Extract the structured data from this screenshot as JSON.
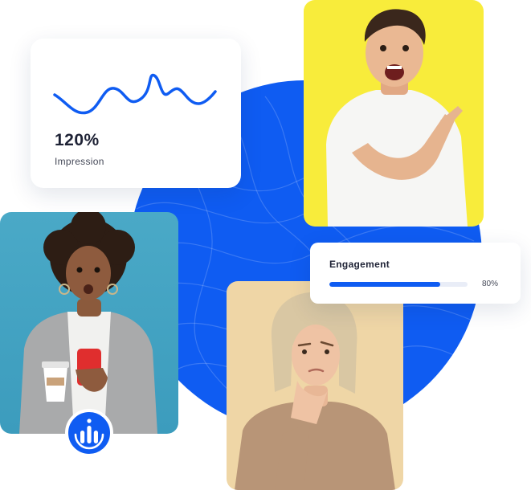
{
  "impression": {
    "value": "120%",
    "label": "Impression"
  },
  "engagement": {
    "title": "Engagement",
    "percent_text": "80%",
    "progress": 0.8
  },
  "colors": {
    "accent": "#0f5cf2",
    "yellow_background": "#f8ec3b",
    "teal_background": "#3c9cbd",
    "beige_background": "#efd6a6"
  },
  "icons": {
    "wave_chart": "sparkline-icon",
    "brand_badge": "bar-chart-logo-icon"
  }
}
